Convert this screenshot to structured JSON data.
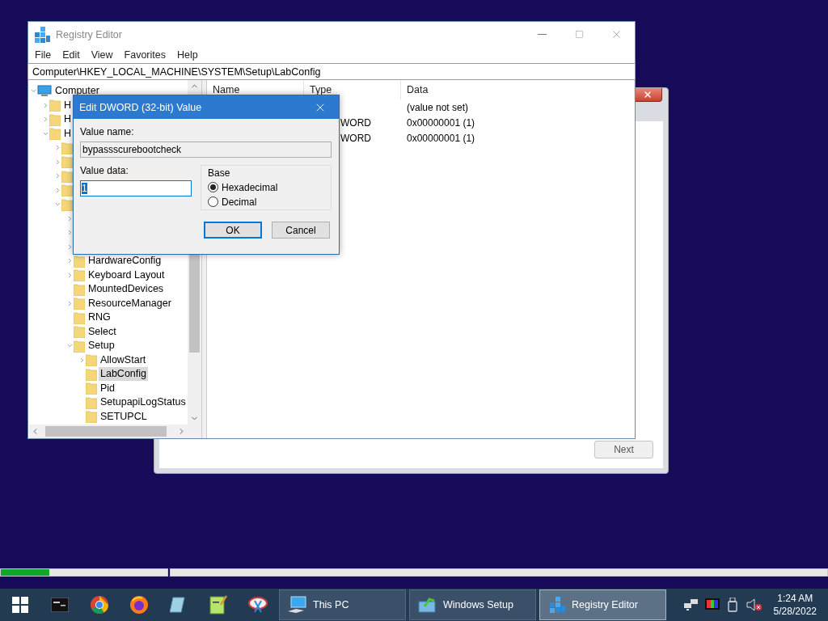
{
  "progress": [
    {
      "level": 0.29
    },
    {
      "level": 0
    }
  ],
  "setup_window": {
    "next_button": "Next"
  },
  "registry_editor": {
    "title": "Registry Editor",
    "menu": [
      "File",
      "Edit",
      "View",
      "Favorites",
      "Help"
    ],
    "address": "Computer\\HKEY_LOCAL_MACHINE\\SYSTEM\\Setup\\LabConfig",
    "tree": [
      {
        "label": "Computer",
        "kind": "computer",
        "expanded": true,
        "selected": false,
        "children": [
          {
            "label": "H",
            "kind": "folder",
            "expanded": false,
            "selected": false
          },
          {
            "label": "H",
            "kind": "folder",
            "expanded": false,
            "selected": false
          },
          {
            "label": "H",
            "kind": "folder",
            "expanded": true,
            "selected": false,
            "children": [
              {
                "kind": "folder",
                "expanded": false
              },
              {
                "kind": "folder",
                "expanded": false
              },
              {
                "kind": "folder",
                "expanded": false
              },
              {
                "kind": "folder",
                "expanded": false
              },
              {
                "kind": "folder",
                "expanded": true,
                "children": [
                  {
                    "expanded": false
                  },
                  {
                    "expanded": false
                  },
                  {
                    "expanded": false
                  },
                  {
                    "label": "HardwareConfig",
                    "kind": "folder",
                    "expanded": false,
                    "selected": false
                  },
                  {
                    "label": "Keyboard Layout",
                    "kind": "folder",
                    "expanded": false,
                    "selected": false
                  },
                  {
                    "label": "MountedDevices",
                    "kind": "folder",
                    "selected": false
                  },
                  {
                    "label": "ResourceManager",
                    "kind": "folder",
                    "expanded": false,
                    "selected": false
                  },
                  {
                    "label": "RNG",
                    "kind": "folder",
                    "selected": false
                  },
                  {
                    "label": "Select",
                    "kind": "folder",
                    "selected": false
                  },
                  {
                    "label": "Setup",
                    "kind": "folder",
                    "expanded": true,
                    "selected": false,
                    "children": [
                      {
                        "label": "AllowStart",
                        "kind": "folder",
                        "expanded": false,
                        "selected": false
                      },
                      {
                        "label": "LabConfig",
                        "kind": "folder",
                        "selected": true
                      },
                      {
                        "label": "Pid",
                        "kind": "folder",
                        "selected": false
                      },
                      {
                        "label": "SetupapiLogStatus",
                        "kind": "folder",
                        "selected": false
                      },
                      {
                        "label": "SETUPCL",
                        "kind": "folder",
                        "selected": false
                      }
                    ]
                  }
                ]
              }
            ]
          }
        ]
      }
    ],
    "list": {
      "columns": [
        "Name",
        "Type",
        "Data"
      ],
      "rows": [
        {
          "data": "(value not set)"
        },
        {
          "type": "WORD",
          "data": "0x00000001 (1)"
        },
        {
          "type": "WORD",
          "data": "0x00000001 (1)"
        }
      ]
    }
  },
  "dialog": {
    "title": "Edit DWORD (32-bit) Value",
    "value_name_label": "Value name:",
    "value_name": "bypassscurebootcheck",
    "value_data_label": "Value data:",
    "value_data": "1",
    "base_label": "Base",
    "radios": [
      {
        "label": "Hexadecimal",
        "selected": true
      },
      {
        "label": "Decimal",
        "selected": false
      }
    ],
    "buttons": [
      {
        "label": "OK",
        "default": true
      },
      {
        "label": "Cancel",
        "default": false
      }
    ]
  },
  "taskbar": {
    "pinned": [
      {
        "kind": "start"
      },
      {
        "kind": "terminal"
      },
      {
        "kind": "chrome"
      },
      {
        "kind": "firefox"
      },
      {
        "kind": "notepad"
      },
      {
        "kind": "editor"
      },
      {
        "kind": "snip"
      }
    ],
    "tasks": [
      {
        "label": "This PC",
        "kind": "computer",
        "selected": false
      },
      {
        "label": "Windows Setup",
        "kind": "setup",
        "selected": false
      },
      {
        "label": "Registry Editor",
        "kind": "registry",
        "selected": true
      }
    ],
    "tray": [
      {
        "kind": "network"
      },
      {
        "kind": "display"
      },
      {
        "kind": "usb"
      },
      {
        "kind": "volume-muted"
      }
    ],
    "clock": {
      "time": "1:24 AM",
      "date": "5/28/2022"
    }
  }
}
